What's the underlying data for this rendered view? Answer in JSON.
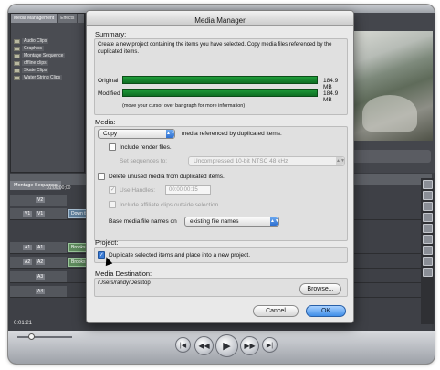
{
  "dialog": {
    "title": "Media Manager",
    "summary": {
      "label": "Summary:",
      "description": "Create a new project containing the items you have selected. Copy media files referenced by the duplicated items.",
      "original_label": "Original",
      "original_size": "184.9 MB",
      "modified_label": "Modified",
      "modified_size": "184.9 MB",
      "hint": "(move your cursor over bar graph for more information)"
    },
    "media": {
      "label": "Media:",
      "mode_value": "Copy",
      "mode_suffix": "media referenced by duplicated items.",
      "include_render_label": "Include render files.",
      "include_render_checked": false,
      "set_sequences_label": "Set sequences to:",
      "set_sequences_value": "Uncompressed 10-bit NTSC 48 kHz",
      "delete_unused_label": "Delete unused media from duplicated items.",
      "delete_unused_checked": false,
      "use_handles_label": "Use Handles:",
      "use_handles_checked": true,
      "handles_value": "00:00:00:15",
      "include_affiliate_label": "Include affiliate clips outside selection.",
      "include_affiliate_checked": false,
      "base_names_label": "Base media file names on",
      "base_names_value": "existing file names"
    },
    "project": {
      "label": "Project:",
      "duplicate_label": "Duplicate selected items and place into a new project.",
      "duplicate_checked": true
    },
    "destination": {
      "label": "Media Destination:",
      "path": "/Users/randy/Desktop",
      "browse_label": "Browse..."
    },
    "cancel_label": "Cancel",
    "ok_label": "OK"
  },
  "browser": {
    "tabs": [
      "Media Management",
      "Effects"
    ],
    "items": [
      "Audio Clips",
      "Graphics",
      "Montage Sequence",
      "offline clips",
      "Skate Clips",
      "Water String Clips"
    ]
  },
  "timeline": {
    "tab": "Montage Sequence",
    "ruler_start": "01:00:00;00",
    "tracks": [
      {
        "a": "V2",
        "b": ""
      },
      {
        "a": "V1",
        "b": "V1"
      },
      {
        "a": "A1",
        "b": "A1"
      },
      {
        "a": "A2",
        "b": "A2"
      },
      {
        "a": "A3",
        "b": ""
      },
      {
        "a": "A4",
        "b": ""
      }
    ],
    "clips": [
      "Down the S",
      "Brooks Mix",
      "Brooks Mix"
    ],
    "timecode": "0:01:21"
  },
  "transport": {
    "buttons": [
      "previous",
      "rewind",
      "play",
      "fast-forward",
      "next"
    ]
  },
  "colors": {
    "bar_green": "#1f9d3a",
    "accent_blue": "#3f8ee8"
  }
}
